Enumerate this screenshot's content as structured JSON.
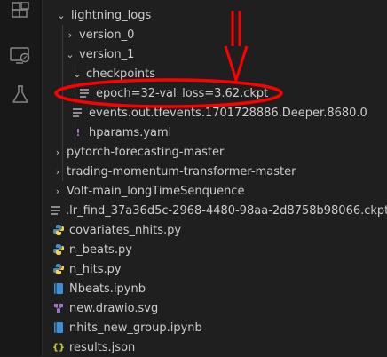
{
  "activity_bar": {
    "icons": [
      "extensions-icon",
      "remote-explorer-icon",
      "testing-flask-icon"
    ]
  },
  "tree": {
    "items": [
      {
        "label": "lightning_logs",
        "type": "folder",
        "expanded": true
      },
      {
        "label": "version_0",
        "type": "folder",
        "expanded": false
      },
      {
        "label": "version_1",
        "type": "folder",
        "expanded": true
      },
      {
        "label": "checkpoints",
        "type": "folder",
        "expanded": true
      },
      {
        "label": "epoch=32-val_loss=3.62.ckpt",
        "type": "file",
        "icon": "lines-file-icon"
      },
      {
        "label": "events.out.tfevents.1701728886.Deeper.8680.0",
        "type": "file",
        "icon": "lines-file-icon"
      },
      {
        "label": "hparams.yaml",
        "type": "file",
        "icon": "yaml-exclamation-icon"
      },
      {
        "label": "pytorch-forecasting-master",
        "type": "folder",
        "expanded": false
      },
      {
        "label": "trading-momentum-transformer-master",
        "type": "folder",
        "expanded": false
      },
      {
        "label": "Volt-main_longTimeSenquence",
        "type": "folder",
        "expanded": false
      },
      {
        "label": ".lr_find_37a36d5c-2968-4480-98aa-2d8758b98066.ckpt",
        "type": "file",
        "icon": "lines-file-icon"
      },
      {
        "label": "covariates_nhits.py",
        "type": "file",
        "icon": "python-icon"
      },
      {
        "label": "n_beats.py",
        "type": "file",
        "icon": "python-icon"
      },
      {
        "label": "n_hits.py",
        "type": "file",
        "icon": "python-icon"
      },
      {
        "label": "Nbeats.ipynb",
        "type": "file",
        "icon": "notebook-icon"
      },
      {
        "label": "new.drawio.svg",
        "type": "file",
        "icon": "svg-file-icon"
      },
      {
        "label": "nhits_new_group.ipynb",
        "type": "file",
        "icon": "notebook-icon"
      },
      {
        "label": "results.json",
        "type": "file",
        "icon": "json-braces-icon"
      }
    ]
  },
  "annotation": {
    "color": "#ff0000",
    "highlighted_item": "epoch=32-val_loss=3.62.ckpt"
  }
}
